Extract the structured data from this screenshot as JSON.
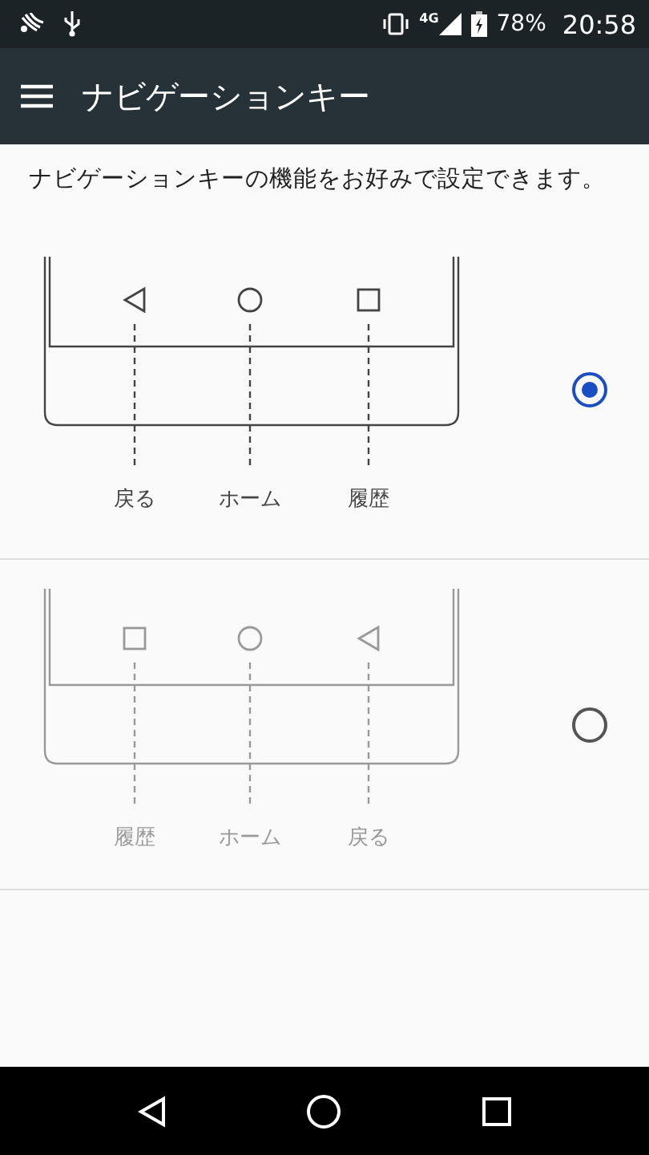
{
  "status_bar": {
    "network_type": "4G",
    "battery": "78%",
    "time": "20:58"
  },
  "toolbar": {
    "title": "ナビゲーションキー"
  },
  "description": "ナビゲーションキーの機能をお好みで設定できます。",
  "options": [
    {
      "selected": true,
      "keys": [
        {
          "kind": "back",
          "label": "戻る"
        },
        {
          "kind": "home",
          "label": "ホーム"
        },
        {
          "kind": "recents",
          "label": "履歴"
        }
      ]
    },
    {
      "selected": false,
      "keys": [
        {
          "kind": "recents",
          "label": "履歴"
        },
        {
          "kind": "home",
          "label": "ホーム"
        },
        {
          "kind": "back",
          "label": "戻る"
        }
      ]
    }
  ]
}
